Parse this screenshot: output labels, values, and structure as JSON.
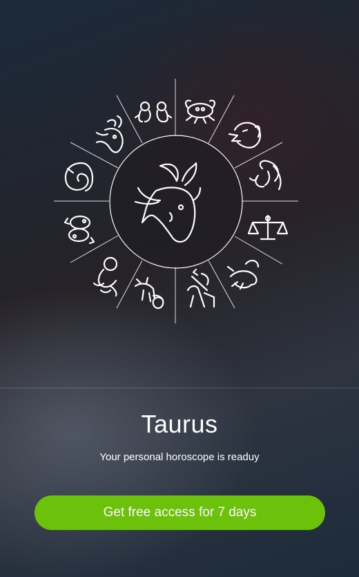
{
  "hero": {
    "selected_sign": "taurus",
    "zodiac_icons": [
      "gemini-icon",
      "cancer-icon",
      "leo-icon",
      "virgo-icon",
      "libra-icon",
      "scorpio-icon",
      "sagittarius-icon",
      "capricorn-icon",
      "aquarius-icon",
      "pisces-icon",
      "aries-icon",
      "taurus-icon"
    ]
  },
  "result": {
    "sign_name": "Taurus",
    "subtitle": "Your personal horoscope is readuy"
  },
  "cta": {
    "label": "Get free access for 7 days",
    "color": "#6cc10a"
  },
  "colors": {
    "line": "#ffffff"
  }
}
